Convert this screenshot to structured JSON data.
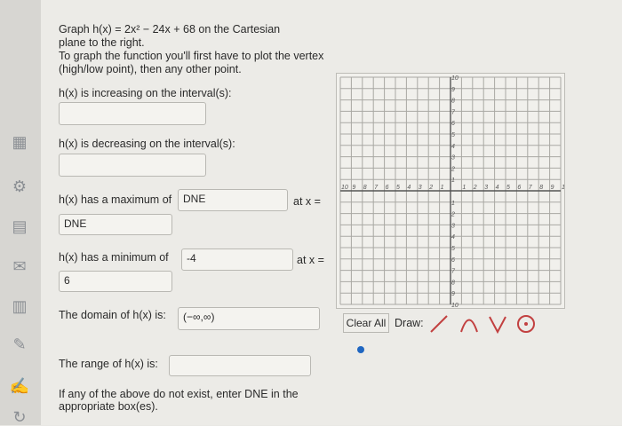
{
  "intro": {
    "line1": "Graph h(x) = 2x² − 24x + 68 on the Cartesian",
    "line2": "plane to the right.",
    "line3": "To graph the function you'll first have to plot the vertex",
    "line4": "(high/low point), then any other point."
  },
  "increasing": {
    "label": "h(x) is increasing on the interval(s):",
    "value": ""
  },
  "decreasing": {
    "label": "h(x) is decreasing on the interval(s):",
    "value": ""
  },
  "maximum": {
    "label": "h(x) has a maximum of",
    "value": "DNE",
    "at_label": "at x =",
    "x_value": "DNE"
  },
  "minimum": {
    "label": "h(x) has a minimum of",
    "value": "-4",
    "at_label": "at x =",
    "x_value": "6"
  },
  "domain": {
    "label": "The domain of h(x) is:",
    "value": "(−∞,∞)"
  },
  "range": {
    "label": "The range of h(x) is:",
    "value": ""
  },
  "note": {
    "line1": "If any of the above do not exist, enter DNE in the",
    "line2": "appropriate box(es)."
  },
  "graph_tools": {
    "clear_all": "Clear All",
    "draw_label": "Draw:",
    "tools": [
      "line-tool-icon",
      "parabola-up-tool-icon",
      "v-shape-tool-icon",
      "circle-tool-icon"
    ]
  },
  "grid": {
    "x_range": [
      -10,
      10
    ],
    "y_range": [
      -10,
      10
    ],
    "x_ticks": [
      "10",
      "9",
      "8",
      "7",
      "6",
      "5",
      "4",
      "3",
      "2",
      "1",
      "1",
      "2",
      "3",
      "4",
      "5",
      "6",
      "7",
      "8",
      "9",
      "10"
    ],
    "y_ticks": [
      "10",
      "9",
      "8",
      "7",
      "6",
      "5",
      "4",
      "3",
      "2",
      "1",
      "1",
      "2",
      "3",
      "4",
      "5",
      "6",
      "7",
      "8",
      "9",
      "10"
    ]
  }
}
